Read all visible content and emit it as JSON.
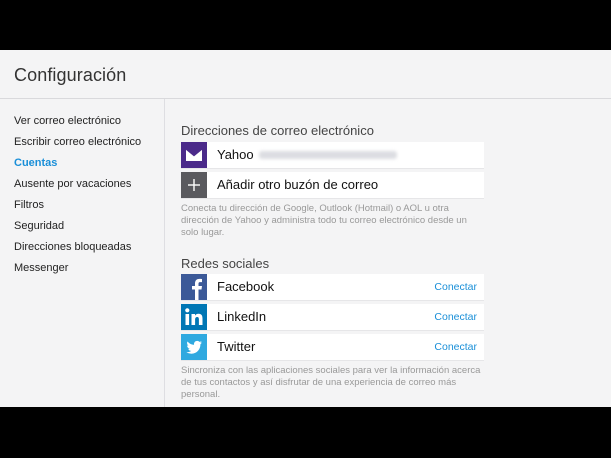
{
  "header": {
    "title": "Configuración"
  },
  "sidebar": {
    "items": [
      {
        "label": "Ver correo electrónico",
        "active": false
      },
      {
        "label": "Escribir correo electrónico",
        "active": false
      },
      {
        "label": "Cuentas",
        "active": true
      },
      {
        "label": "Ausente por vacaciones",
        "active": false
      },
      {
        "label": "Filtros",
        "active": false
      },
      {
        "label": "Seguridad",
        "active": false
      },
      {
        "label": "Direcciones bloqueadas",
        "active": false
      },
      {
        "label": "Messenger",
        "active": false
      }
    ]
  },
  "emails": {
    "title": "Direcciones de correo electrónico",
    "accounts": [
      {
        "label": "Yahoo",
        "icon": "yahoo-mail-icon"
      },
      {
        "label": "Añadir otro buzón de correo",
        "icon": "plus-icon"
      }
    ],
    "description": "Conecta tu dirección de Google, Outlook (Hotmail) o AOL u otra dirección de Yahoo y administra todo tu correo electrónico desde un solo lugar."
  },
  "social": {
    "title": "Redes sociales",
    "networks": [
      {
        "label": "Facebook",
        "action": "Conectar",
        "icon": "facebook-icon",
        "color": "#3b5998"
      },
      {
        "label": "LinkedIn",
        "action": "Conectar",
        "icon": "linkedin-icon",
        "color": "#0077b5"
      },
      {
        "label": "Twitter",
        "action": "Conectar",
        "icon": "twitter-icon",
        "color": "#2fa9e0"
      }
    ],
    "description": "Sincroniza con las aplicaciones sociales para ver la información acerca de tus contactos y así disfrutar de una experiencia de correo más personal."
  },
  "colors": {
    "accent": "#1a8fd8",
    "yahoo_purple": "#4b2a8a"
  }
}
